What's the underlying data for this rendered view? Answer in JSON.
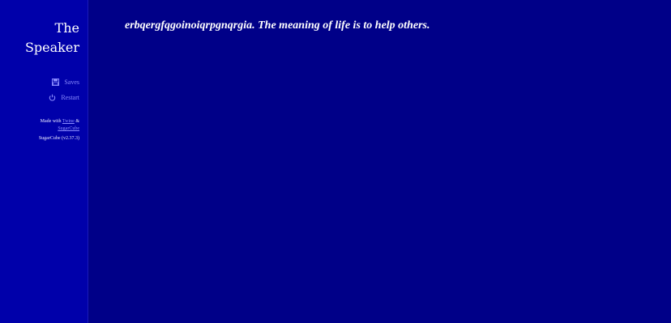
{
  "ui_bar": {
    "title": "The Speaker",
    "menu": [
      {
        "label": "Saves",
        "icon": "saves-icon"
      },
      {
        "label": "Restart",
        "icon": "restart-icon"
      }
    ],
    "credits": {
      "made_with_prefix": "Made with",
      "twine_link": "Twine",
      "ampersand": "&",
      "sugarcube_link": "SugarCube",
      "version": "SugarCube (v2.37.3)"
    }
  },
  "passage": {
    "text": "erbqergfqgoinoiqrpgnqrgia. The meaning of life is to help others."
  },
  "colors": {
    "background": "#000088",
    "ui_bar": "#0000aa",
    "link": "#8b8cff",
    "text": "#ffffff"
  }
}
